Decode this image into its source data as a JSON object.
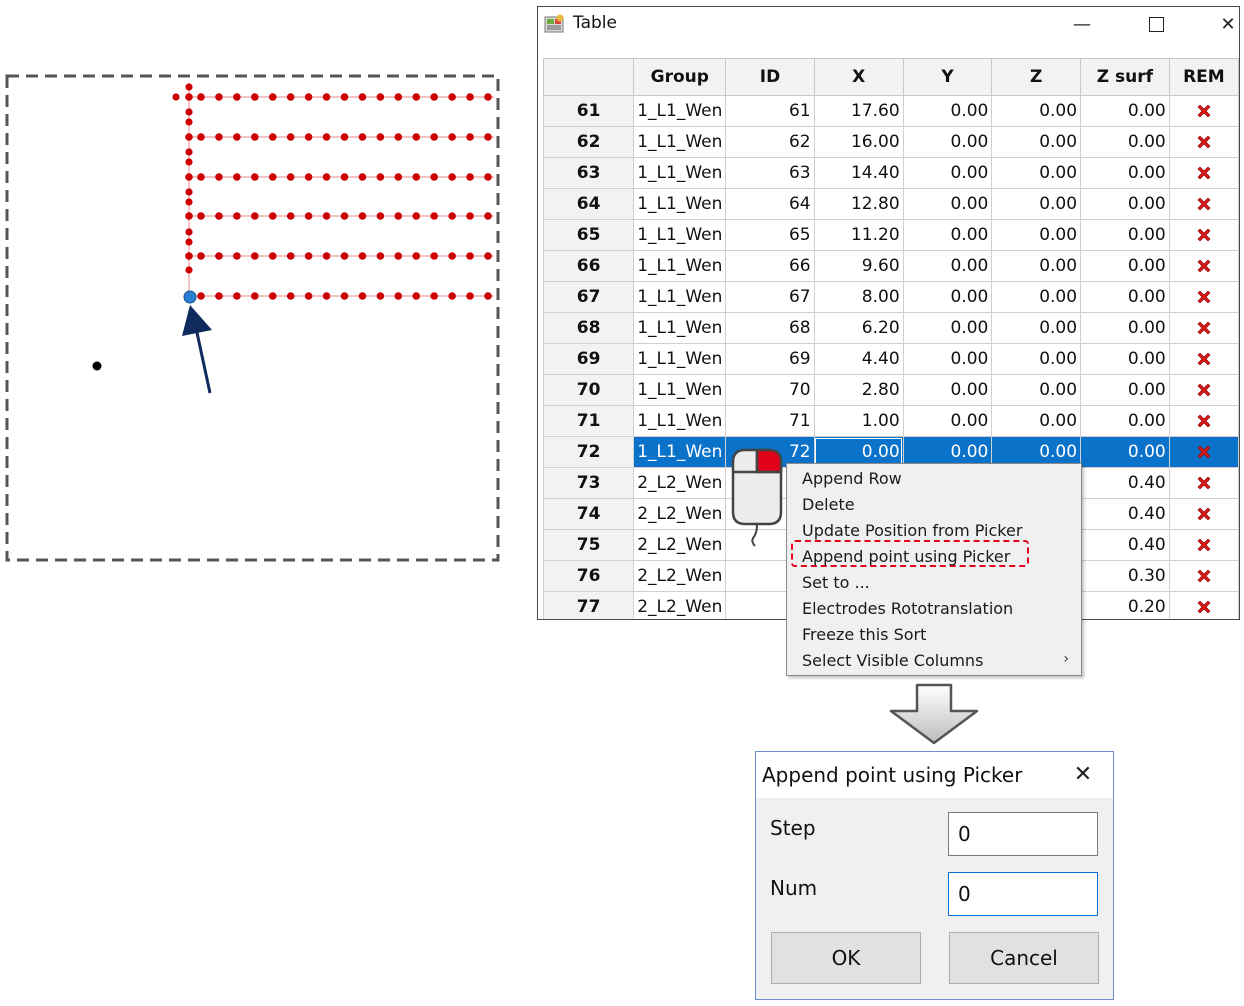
{
  "window": {
    "title": "Table",
    "icon": "table-app-icon",
    "controls": [
      "minimize-icon",
      "maximize-icon",
      "close-icon"
    ]
  },
  "table": {
    "columns": [
      "",
      "Group",
      "ID",
      "X",
      "Y",
      "Z",
      "Z surf",
      "REM"
    ],
    "selected_row": "72",
    "rows": [
      {
        "row": "61",
        "group": "1_L1_Wen",
        "id": "61",
        "x": "17.60",
        "y": "0.00",
        "z": "0.00",
        "zsurf": "0.00"
      },
      {
        "row": "62",
        "group": "1_L1_Wen",
        "id": "62",
        "x": "16.00",
        "y": "0.00",
        "z": "0.00",
        "zsurf": "0.00"
      },
      {
        "row": "63",
        "group": "1_L1_Wen",
        "id": "63",
        "x": "14.40",
        "y": "0.00",
        "z": "0.00",
        "zsurf": "0.00"
      },
      {
        "row": "64",
        "group": "1_L1_Wen",
        "id": "64",
        "x": "12.80",
        "y": "0.00",
        "z": "0.00",
        "zsurf": "0.00"
      },
      {
        "row": "65",
        "group": "1_L1_Wen",
        "id": "65",
        "x": "11.20",
        "y": "0.00",
        "z": "0.00",
        "zsurf": "0.00"
      },
      {
        "row": "66",
        "group": "1_L1_Wen",
        "id": "66",
        "x": "9.60",
        "y": "0.00",
        "z": "0.00",
        "zsurf": "0.00"
      },
      {
        "row": "67",
        "group": "1_L1_Wen",
        "id": "67",
        "x": "8.00",
        "y": "0.00",
        "z": "0.00",
        "zsurf": "0.00"
      },
      {
        "row": "68",
        "group": "1_L1_Wen",
        "id": "68",
        "x": "6.20",
        "y": "0.00",
        "z": "0.00",
        "zsurf": "0.00"
      },
      {
        "row": "69",
        "group": "1_L1_Wen",
        "id": "69",
        "x": "4.40",
        "y": "0.00",
        "z": "0.00",
        "zsurf": "0.00"
      },
      {
        "row": "70",
        "group": "1_L1_Wen",
        "id": "70",
        "x": "2.80",
        "y": "0.00",
        "z": "0.00",
        "zsurf": "0.00"
      },
      {
        "row": "71",
        "group": "1_L1_Wen",
        "id": "71",
        "x": "1.00",
        "y": "0.00",
        "z": "0.00",
        "zsurf": "0.00"
      },
      {
        "row": "72",
        "group": "1_L1_Wen",
        "id": "72",
        "x": "0.00",
        "y": "0.00",
        "z": "0.00",
        "zsurf": "0.00"
      },
      {
        "row": "73",
        "group": "2_L2_Wen",
        "id": "",
        "x": "",
        "y": "",
        "z": "",
        "zsurf": "0.40"
      },
      {
        "row": "74",
        "group": "2_L2_Wen",
        "id": "",
        "x": "",
        "y": "",
        "z": "",
        "zsurf": "0.40"
      },
      {
        "row": "75",
        "group": "2_L2_Wen",
        "id": "",
        "x": "",
        "y": "",
        "z": "",
        "zsurf": "0.40"
      },
      {
        "row": "76",
        "group": "2_L2_Wen",
        "id": "",
        "x": "",
        "y": "",
        "z": "",
        "zsurf": "0.30"
      },
      {
        "row": "77",
        "group": "2_L2_Wen",
        "id": "",
        "x": "",
        "y": "",
        "z": "",
        "zsurf": "0.20"
      }
    ],
    "rem_icon": "red-x-delete-icon"
  },
  "context_menu": {
    "items": [
      {
        "label": "Append Row"
      },
      {
        "label": "Delete"
      },
      {
        "label": "Update Position from Picker"
      },
      {
        "label": "Append point using Picker",
        "highlighted": true
      },
      {
        "label": "Set to ..."
      },
      {
        "label": "Electrodes Rototranslation"
      },
      {
        "label": "Freeze this Sort"
      },
      {
        "label": "Select Visible Columns",
        "submenu_arrow": "›"
      }
    ]
  },
  "dialog": {
    "title": "Append point using Picker",
    "close_glyph": "✕",
    "step_label": "Step",
    "step_value": "0",
    "num_label": "Num",
    "num_value": "0",
    "ok_label": "OK",
    "cancel_label": "Cancel"
  },
  "colors": {
    "point_red": "#cc0000",
    "picked_point_blue": "#2a7fd4",
    "arrow_navy": "#0f2a5c",
    "selection_blue": "#0a72c9",
    "highlight_dashed_red": "#e0001a"
  },
  "plot": {
    "rows_of_points": 6,
    "points_per_row": 17
  }
}
